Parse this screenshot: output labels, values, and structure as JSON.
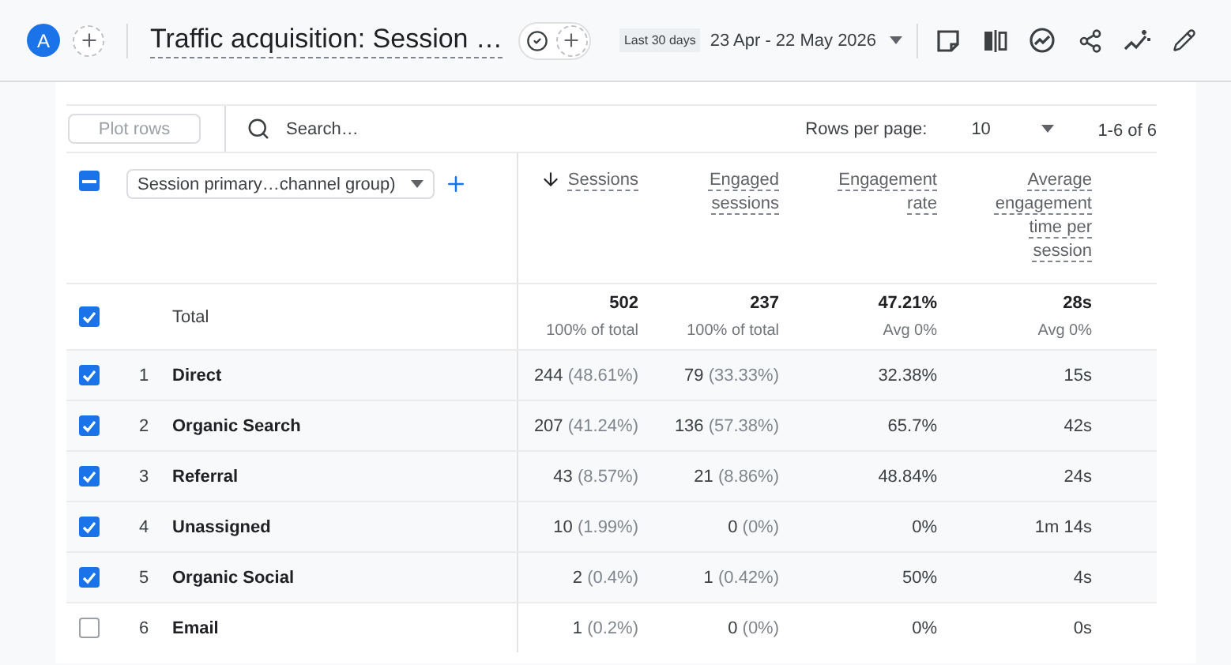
{
  "header": {
    "avatar": "A",
    "title": "Traffic acquisition: Session …",
    "date_chip": "Last 30 days",
    "date_range": "23 Apr - 22 May 2026"
  },
  "toolbar": {
    "plot_button": {
      "label": "Plot rows",
      "disabled": true
    },
    "search": {
      "placeholder": "Search…"
    },
    "rows_per_page_label": "Rows per page:",
    "rows_per_page": "10",
    "pagination": "1-6 of 6"
  },
  "table": {
    "select_all": {
      "indeterminate": true
    },
    "dimension": "Session primary…channel group)",
    "columns": [
      {
        "label": "Sessions",
        "sorted": true
      },
      {
        "label": "Engaged sessions",
        "sorted": false
      },
      {
        "label": "Engagement rate",
        "sorted": false
      },
      {
        "label": "Average engagement time per session",
        "sorted": false
      }
    ],
    "total": {
      "checked": true,
      "label": "Total",
      "cells": [
        {
          "value": "502",
          "sub": "100% of total"
        },
        {
          "value": "237",
          "sub": "100% of total"
        },
        {
          "value": "47.21%",
          "sub": "Avg 0%"
        },
        {
          "value": "28s",
          "sub": "Avg 0%"
        }
      ]
    },
    "rows": [
      {
        "checked": true,
        "rank": "1",
        "channel": "Direct",
        "cells": [
          {
            "value": "244",
            "pct": "(48.61%)"
          },
          {
            "value": "79",
            "pct": "(33.33%)"
          },
          {
            "value": "32.38%"
          },
          {
            "value": "15s"
          }
        ]
      },
      {
        "checked": true,
        "rank": "2",
        "channel": "Organic Search",
        "cells": [
          {
            "value": "207",
            "pct": "(41.24%)"
          },
          {
            "value": "136",
            "pct": "(57.38%)"
          },
          {
            "value": "65.7%"
          },
          {
            "value": "42s"
          }
        ]
      },
      {
        "checked": true,
        "rank": "3",
        "channel": "Referral",
        "cells": [
          {
            "value": "43",
            "pct": "(8.57%)"
          },
          {
            "value": "21",
            "pct": "(8.86%)"
          },
          {
            "value": "48.84%"
          },
          {
            "value": "24s"
          }
        ]
      },
      {
        "checked": true,
        "rank": "4",
        "channel": "Unassigned",
        "cells": [
          {
            "value": "10",
            "pct": "(1.99%)"
          },
          {
            "value": "0",
            "pct": "(0%)"
          },
          {
            "value": "0%"
          },
          {
            "value": "1m 14s"
          }
        ]
      },
      {
        "checked": true,
        "rank": "5",
        "channel": "Organic Social",
        "cells": [
          {
            "value": "2",
            "pct": "(0.4%)"
          },
          {
            "value": "1",
            "pct": "(0.42%)"
          },
          {
            "value": "50%"
          },
          {
            "value": "4s"
          }
        ]
      },
      {
        "checked": false,
        "rank": "6",
        "channel": "Email",
        "cells": [
          {
            "value": "1",
            "pct": "(0.2%)"
          },
          {
            "value": "0",
            "pct": "(0%)"
          },
          {
            "value": "0%"
          },
          {
            "value": "0s"
          }
        ]
      }
    ]
  }
}
